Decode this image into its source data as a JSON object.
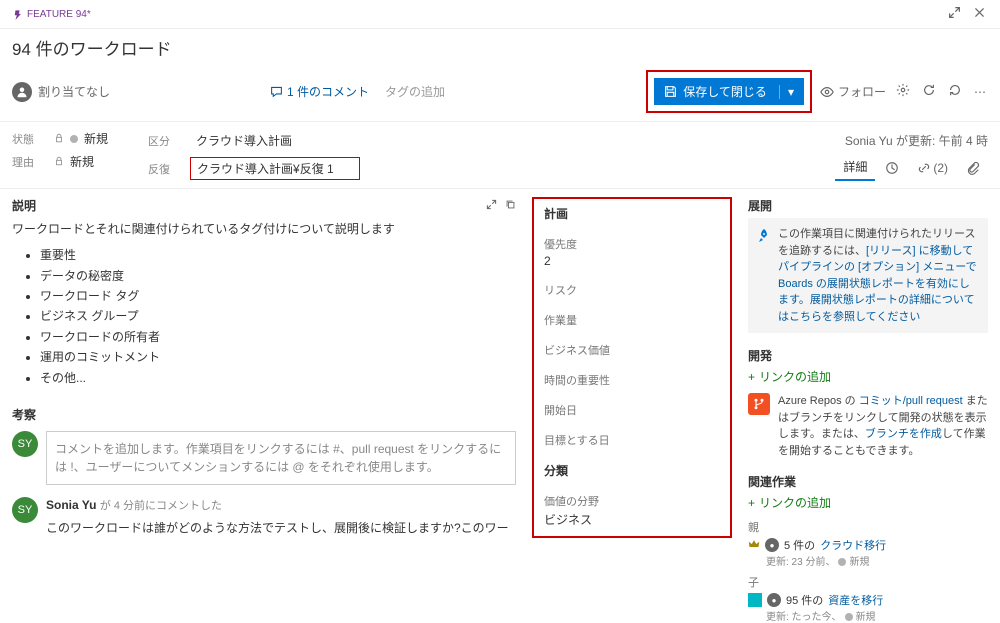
{
  "header": {
    "feature_label": "FEATURE 94*",
    "title": "94 件のワークロード",
    "unassigned": "割り当てなし",
    "comment_count": "1 件のコメント",
    "add_tag": "タグの追加",
    "save_close": "保存して閉じる",
    "follow": "フォロー",
    "updated_by": "Sonia Yu が更新: 午前 4 時"
  },
  "classification": {
    "state_label": "状態",
    "state_value": "新規",
    "reason_label": "理由",
    "reason_value": "新規",
    "area_label": "区分",
    "area_value": "クラウド導入計画",
    "iteration_label": "反復",
    "iteration_value": "クラウド導入計画¥反復 1"
  },
  "tabs": {
    "details": "詳細",
    "links_count": "(2)"
  },
  "description": {
    "header": "説明",
    "intro": "ワークロードとそれに関連付けられているタグ付けについて説明します",
    "items": [
      "重要性",
      "データの秘密度",
      "ワークロード タグ",
      "ビジネス グループ",
      "ワークロードの所有者",
      "運用のコミットメント",
      "その他..."
    ]
  },
  "discussion": {
    "header": "考察",
    "placeholder": "コメントを追加します。作業項目をリンクするには #、pull request をリンクするには !、ユーザーについてメンションするには @ をそれぞれ使用します。",
    "author": "Sonia Yu",
    "time": "が 4 分前にコメントした",
    "body": "このワークロードは誰がどのような方法でテストし、展開後に検証しますか?このワークロードの場合、展開プランとは何ですか?"
  },
  "planning": {
    "header": "計画",
    "priority_label": "優先度",
    "priority_value": "2",
    "risk_label": "リスク",
    "effort_label": "作業量",
    "bv_label": "ビジネス価値",
    "tc_label": "時間の重要性",
    "start_label": "開始日",
    "target_label": "目標とする日",
    "class_header": "分類",
    "value_area_label": "価値の分野",
    "value_area_value": "ビジネス"
  },
  "deployment": {
    "header": "展開",
    "text1": "この作業項目に関連付けられたリリースを追跡するには、",
    "text2": "[リリース] に移動してパイプラインの [オプション] メニューで Boards の展開状態レポートを有効にします。",
    "text3": "展開状態レポートの詳細についてはこちらを参照してください"
  },
  "development": {
    "header": "開発",
    "add_link": "リンクの追加",
    "repo_text1": "Azure Repos の ",
    "repo_link1": "コミット/pull request",
    "repo_text2": " またはブランチをリンクして開発の状態を表示します。または、",
    "repo_link2": "ブランチを作成",
    "repo_text3": "して作業を開始することもできます。"
  },
  "related": {
    "header": "関連作業",
    "add_link": "リンクの追加",
    "parent_label": "親",
    "parent_item": "5 件の",
    "parent_link": "クラウド移行",
    "parent_updated": "更新: 23 分前、",
    "parent_state": "新規",
    "child_label": "子",
    "child_item": "95 件の",
    "child_link": "資産を移行",
    "child_updated": "更新: たった今、",
    "child_state": "新規"
  }
}
